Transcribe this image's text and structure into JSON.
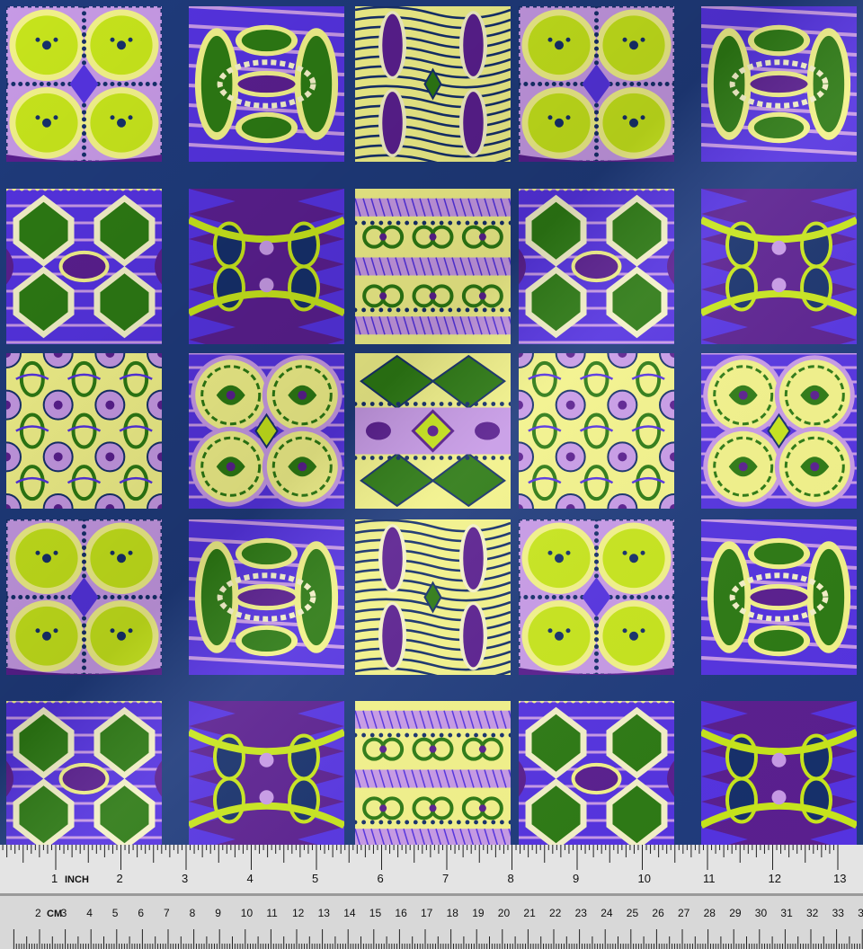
{
  "image": {
    "subject": "fabric-swatch",
    "palette": {
      "background_navy": "#1f3b7c",
      "lime": "#c7e51c",
      "pale_yellow": "#f2f28a",
      "green": "#2d7a14",
      "purple": "#5a1f8f",
      "lilac": "#c79ae6",
      "blue_violet": "#5533e0",
      "cream": "#f4f1c8",
      "dark_navy": "#16306b"
    },
    "tile_patterns": [
      [
        "lime-ovals",
        "green-lattice",
        "zebra-stripes",
        "lime-ovals",
        "green-lattice"
      ],
      [
        "green-diamonds",
        "figure-eight",
        "butterfly-band",
        "green-diamonds",
        "figure-eight"
      ],
      [
        "filigree",
        "medallion-rings",
        "green-kite",
        "filigree",
        "medallion-rings"
      ],
      [
        "lime-ovals",
        "green-lattice",
        "zebra-stripes",
        "lime-ovals",
        "green-lattice"
      ],
      [
        "green-diamonds",
        "figure-eight",
        "butterfly-band",
        "green-diamonds",
        "figure-eight"
      ]
    ]
  },
  "ruler": {
    "inch_unit_label": "INCH",
    "cm_unit_label": "CM",
    "inch_numbers": [
      "1",
      "2",
      "3",
      "4",
      "5",
      "6",
      "7",
      "8",
      "9",
      "10",
      "11",
      "12",
      "13"
    ],
    "cm_numbers": [
      "2",
      "3",
      "4",
      "5",
      "6",
      "7",
      "8",
      "9",
      "10",
      "11",
      "12",
      "13",
      "14",
      "15",
      "16",
      "17",
      "18",
      "19",
      "20",
      "21",
      "22",
      "23",
      "24",
      "25",
      "26",
      "27",
      "28",
      "29",
      "30",
      "31",
      "32",
      "33",
      "3"
    ]
  }
}
